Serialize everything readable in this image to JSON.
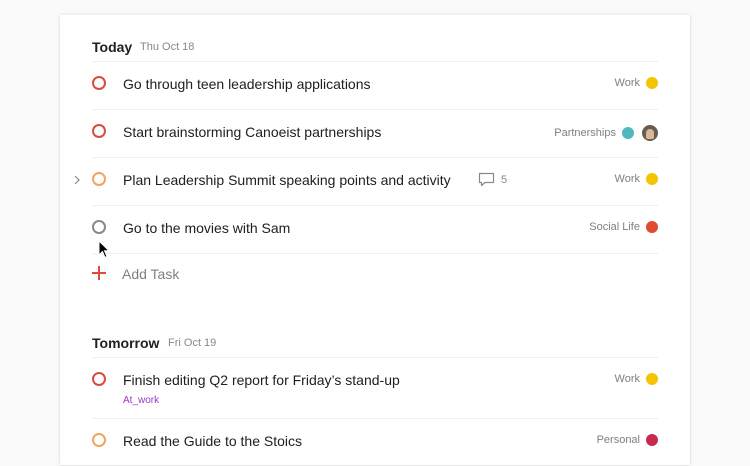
{
  "colors": {
    "priority1": "#db4c3f",
    "priority2": "#f4a35c",
    "default_check": "#8a8a8a",
    "work": "#f5c400",
    "partnerships": "#4fb8be",
    "social_life": "#e2492f",
    "personal": "#c8294f",
    "label": "#a035c9",
    "add": "#dd4b39"
  },
  "sections": {
    "today": {
      "title": "Today",
      "date": "Thu Oct 18",
      "tasks": [
        {
          "text": "Go through teen leadership applications",
          "project": "Work"
        },
        {
          "text": "Start brainstorming Canoeist partnerships",
          "project": "Partnerships"
        },
        {
          "text": "Plan Leadership Summit speaking points and activity",
          "project": "Work",
          "comments": "5"
        },
        {
          "text": "Go to the movies with Sam",
          "project": "Social Life"
        }
      ],
      "add_task": "Add Task"
    },
    "tomorrow": {
      "title": "Tomorrow",
      "date": "Fri Oct 19",
      "tasks": [
        {
          "text": "Finish editing Q2 report for Friday’s stand-up",
          "project": "Work",
          "label": "At_work"
        },
        {
          "text": "Read the Guide to the Stoics",
          "project": "Personal"
        }
      ]
    }
  }
}
